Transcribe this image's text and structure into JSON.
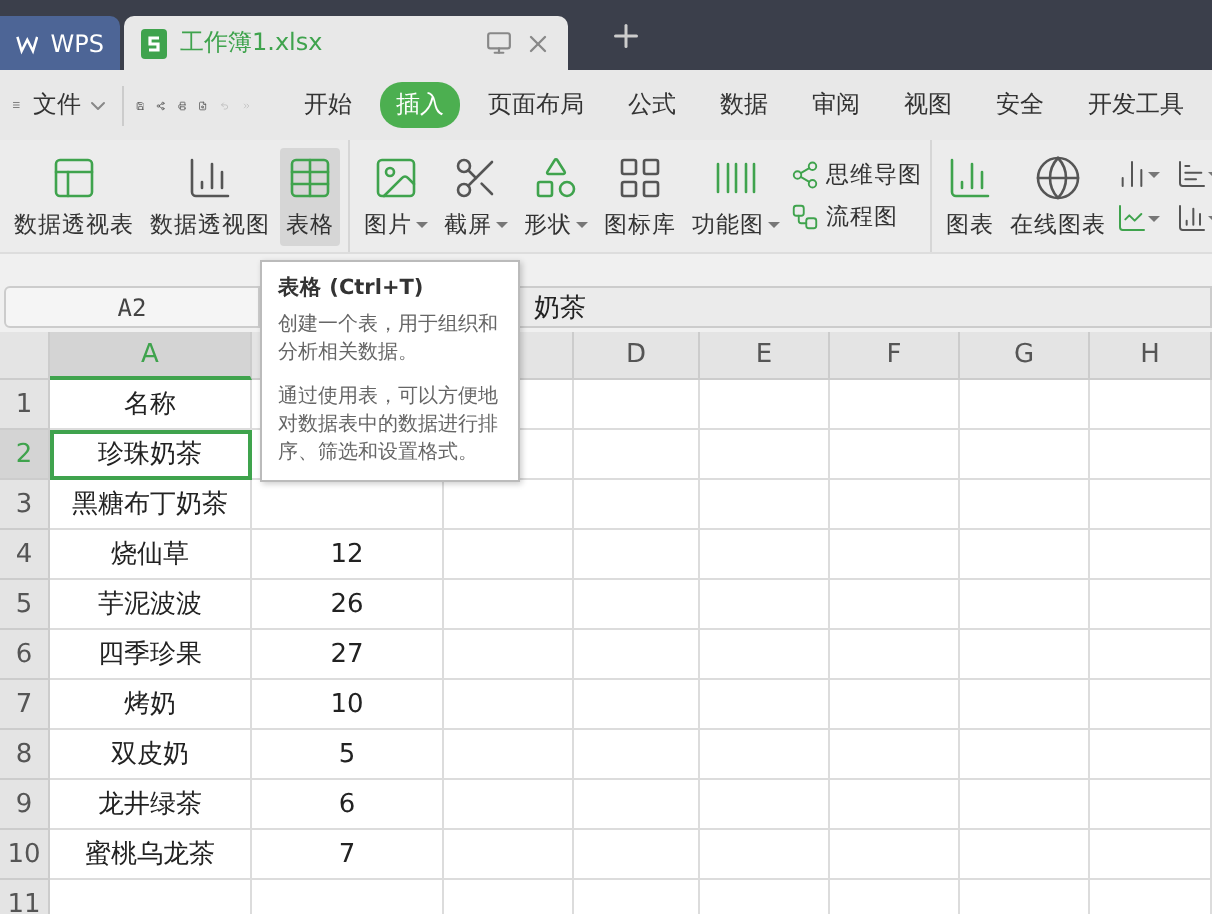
{
  "app_tabs": [
    {
      "label": "WPS",
      "kind": "home",
      "selected": false
    },
    {
      "label": "工作簿1.xlsx",
      "kind": "document",
      "selected": true
    }
  ],
  "menu": {
    "file_label": "文件",
    "tabs": [
      {
        "label": "开始",
        "selected": false
      },
      {
        "label": "插入",
        "selected": true
      },
      {
        "label": "页面布局",
        "selected": false
      },
      {
        "label": "公式",
        "selected": false
      },
      {
        "label": "数据",
        "selected": false
      },
      {
        "label": "审阅",
        "selected": false
      },
      {
        "label": "视图",
        "selected": false
      },
      {
        "label": "安全",
        "selected": false
      },
      {
        "label": "开发工具",
        "selected": false
      }
    ]
  },
  "ribbon": {
    "groups": [
      {
        "items": [
          {
            "kind": "large",
            "label": "数据透视表",
            "dropdown": false,
            "selected": false
          },
          {
            "kind": "large",
            "label": "数据透视图",
            "dropdown": false,
            "selected": false
          },
          {
            "kind": "large",
            "label": "表格",
            "dropdown": false,
            "selected": true
          }
        ]
      },
      {
        "items": [
          {
            "kind": "large",
            "label": "图片",
            "dropdown": true,
            "selected": false
          },
          {
            "kind": "large",
            "label": "截屏",
            "dropdown": true,
            "selected": false
          },
          {
            "kind": "large",
            "label": "形状",
            "dropdown": true,
            "selected": false
          },
          {
            "kind": "large",
            "label": "图标库",
            "dropdown": false,
            "selected": false
          },
          {
            "kind": "large",
            "label": "功能图",
            "dropdown": true,
            "selected": false
          },
          {
            "kind": "stack",
            "items": [
              {
                "label": "思维导图"
              },
              {
                "label": "流程图"
              }
            ]
          }
        ]
      },
      {
        "items": [
          {
            "kind": "large",
            "label": "图表",
            "dropdown": false,
            "selected": false
          },
          {
            "kind": "large",
            "label": "在线图表",
            "dropdown": false,
            "selected": false
          },
          {
            "kind": "icon_grid",
            "items": [
              {
                "dropdown": true
              },
              {
                "dropdown": true
              },
              {
                "dropdown": true
              },
              {
                "dropdown": true
              }
            ]
          }
        ]
      }
    ]
  },
  "formula_bar": {
    "cell_ref": "A2",
    "content": "奶茶"
  },
  "sheet": {
    "columns": [
      {
        "label": "A",
        "selected": true
      },
      {
        "selected": false
      },
      {
        "selected": false
      },
      {
        "label": "D",
        "selected": false
      },
      {
        "label": "E",
        "selected": false
      },
      {
        "label": "F",
        "selected": false
      },
      {
        "label": "G",
        "selected": false
      },
      {
        "label": "H",
        "selected": false
      }
    ],
    "rows": [
      {
        "number": "1",
        "name": "名称",
        "selected": false
      },
      {
        "number": "2",
        "name": "珍珠奶茶",
        "selected": true
      },
      {
        "number": "3",
        "name": "黑糖布丁奶茶",
        "selected": false
      },
      {
        "number": "4",
        "name": "烧仙草",
        "value": "12",
        "selected": false
      },
      {
        "number": "5",
        "name": "芋泥波波",
        "value": "26",
        "selected": false
      },
      {
        "number": "6",
        "name": "四季珍果",
        "value": "27",
        "selected": false
      },
      {
        "number": "7",
        "name": "烤奶",
        "value": "10",
        "selected": false
      },
      {
        "number": "8",
        "name": "双皮奶",
        "value": "5",
        "selected": false
      },
      {
        "number": "9",
        "name": "龙井绿茶",
        "value": "6",
        "selected": false
      },
      {
        "number": "10",
        "name": "蜜桃乌龙茶",
        "value": "7",
        "selected": false
      },
      {
        "number": "11",
        "selected": false
      }
    ]
  },
  "tooltip": {
    "title": "表格 (Ctrl+T)",
    "paragraphs": [
      "创建一个表，用于组织和分析相关数据。",
      "通过使用表，可以方便地对数据表中的数据进行排序、筛选和设置格式。"
    ]
  }
}
